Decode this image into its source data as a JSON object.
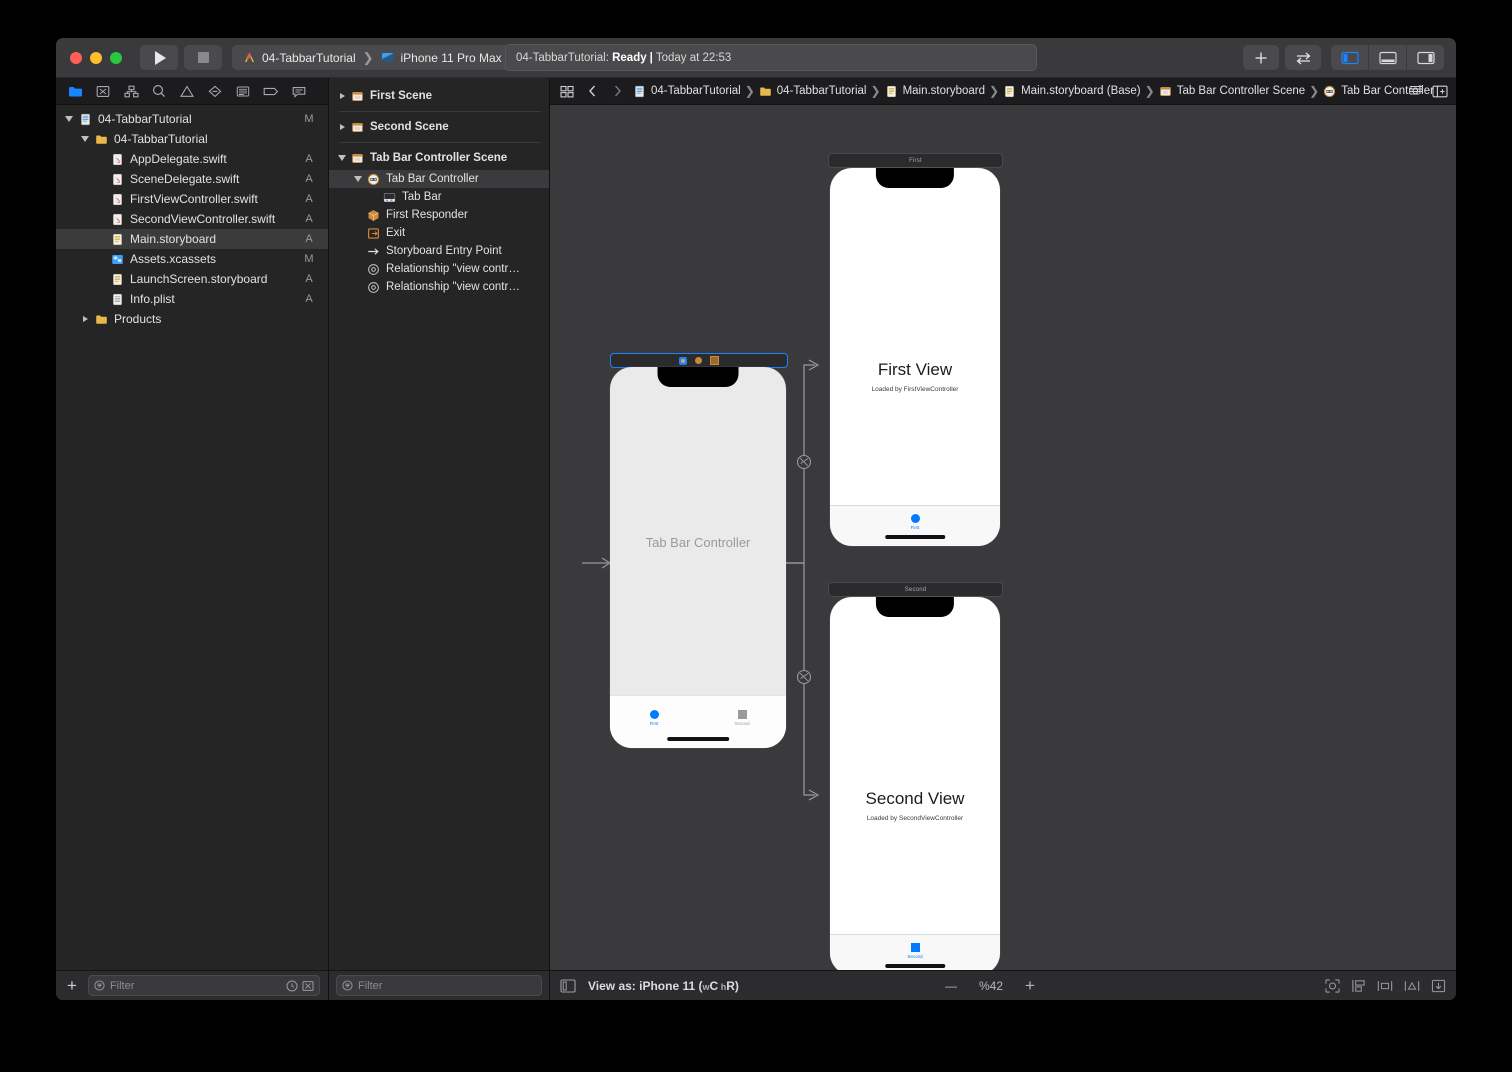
{
  "window": {
    "traffic_lights": [
      "close",
      "minimize",
      "zoom"
    ]
  },
  "toolbar": {
    "run_label": "Run",
    "stop_label": "Stop",
    "scheme_name": "04-TabbarTutorial",
    "destination_name": "iPhone 11 Pro Max",
    "status_project": "04-TabbarTutorial:",
    "status_state": "Ready",
    "status_separator": "|",
    "status_time": "Today at 22:53",
    "add_label": "+",
    "panel_left_label": "Navigator",
    "panel_bottom_label": "Debug Area",
    "panel_right_label": "Inspector",
    "accent_color": "#1a84ff"
  },
  "navigator": {
    "toolbar_icons": [
      "project-navigator-icon",
      "source-control-navigator-icon",
      "symbol-navigator-icon",
      "find-navigator-icon",
      "issue-navigator-icon",
      "test-navigator-icon",
      "debug-navigator-icon",
      "breakpoint-navigator-icon",
      "report-navigator-icon"
    ],
    "files": [
      {
        "label": "04-TabbarTutorial",
        "badge": "M",
        "indent": 0,
        "icon": "xcode-project-icon",
        "disclosure": "open",
        "selected": false
      },
      {
        "label": "04-TabbarTutorial",
        "badge": "",
        "indent": 1,
        "icon": "folder-icon",
        "disclosure": "open",
        "selected": false
      },
      {
        "label": "AppDelegate.swift",
        "badge": "A",
        "indent": 2,
        "icon": "swift-file-icon",
        "disclosure": "none",
        "selected": false
      },
      {
        "label": "SceneDelegate.swift",
        "badge": "A",
        "indent": 2,
        "icon": "swift-file-icon",
        "disclosure": "none",
        "selected": false
      },
      {
        "label": "FirstViewController.swift",
        "badge": "A",
        "indent": 2,
        "icon": "swift-file-icon",
        "disclosure": "none",
        "selected": false
      },
      {
        "label": "SecondViewController.swift",
        "badge": "A",
        "indent": 2,
        "icon": "swift-file-icon",
        "disclosure": "none",
        "selected": false
      },
      {
        "label": "Main.storyboard",
        "badge": "A",
        "indent": 2,
        "icon": "storyboard-file-icon",
        "disclosure": "none",
        "selected": true
      },
      {
        "label": "Assets.xcassets",
        "badge": "M",
        "indent": 2,
        "icon": "assets-catalog-icon",
        "disclosure": "none",
        "selected": false
      },
      {
        "label": "LaunchScreen.storyboard",
        "badge": "A",
        "indent": 2,
        "icon": "storyboard-file-icon",
        "disclosure": "none",
        "selected": false
      },
      {
        "label": "Info.plist",
        "badge": "A",
        "indent": 2,
        "icon": "plist-file-icon",
        "disclosure": "none",
        "selected": false
      },
      {
        "label": "Products",
        "badge": "",
        "indent": 1,
        "icon": "folder-icon",
        "disclosure": "closed",
        "selected": false
      }
    ],
    "footer": {
      "add_label": "+",
      "filter_placeholder": "Filter",
      "filter_value": "",
      "recent_icon": "clock-icon",
      "scm_icon": "source-control-icon"
    }
  },
  "outline": {
    "rows": [
      {
        "label": "First Scene",
        "indent": 0,
        "icon": "scene-icon",
        "disclosure": "closed",
        "selected": false,
        "type": "scene"
      },
      {
        "label": "Second Scene",
        "indent": 0,
        "icon": "scene-icon",
        "disclosure": "closed",
        "selected": false,
        "type": "scene"
      },
      {
        "label": "Tab Bar Controller Scene",
        "indent": 0,
        "icon": "scene-icon",
        "disclosure": "open",
        "selected": false,
        "type": "scene"
      },
      {
        "label": "Tab Bar Controller",
        "indent": 1,
        "icon": "tab-bar-controller-icon",
        "disclosure": "open",
        "selected": true,
        "type": "item"
      },
      {
        "label": "Tab Bar",
        "indent": 2,
        "icon": "tab-bar-icon",
        "disclosure": "none",
        "selected": false,
        "type": "item"
      },
      {
        "label": "First Responder",
        "indent": 1,
        "icon": "first-responder-icon",
        "disclosure": "none",
        "selected": false,
        "type": "item"
      },
      {
        "label": "Exit",
        "indent": 1,
        "icon": "exit-icon",
        "disclosure": "none",
        "selected": false,
        "type": "item"
      },
      {
        "label": "Storyboard Entry Point",
        "indent": 1,
        "icon": "entry-point-icon",
        "disclosure": "none",
        "selected": false,
        "type": "item"
      },
      {
        "label": "Relationship \"view contr…",
        "indent": 1,
        "icon": "relationship-segue-icon",
        "disclosure": "none",
        "selected": false,
        "type": "item"
      },
      {
        "label": "Relationship \"view contr…",
        "indent": 1,
        "icon": "relationship-segue-icon",
        "disclosure": "none",
        "selected": false,
        "type": "item"
      }
    ],
    "footer": {
      "filter_placeholder": "Filter",
      "filter_value": ""
    }
  },
  "jump_bar": {
    "grid_icon": "related-items-icon",
    "back_label": "Back",
    "forward_label": "Forward",
    "crumbs": [
      {
        "label": "04-TabbarTutorial",
        "icon": "xcode-project-icon"
      },
      {
        "label": "04-TabbarTutorial",
        "icon": "folder-icon"
      },
      {
        "label": "Main.storyboard",
        "icon": "storyboard-file-icon"
      },
      {
        "label": "Main.storyboard (Base)",
        "icon": "storyboard-file-icon"
      },
      {
        "label": "Tab Bar Controller Scene",
        "icon": "scene-icon"
      },
      {
        "label": "Tab Bar Controller",
        "icon": "tab-bar-controller-icon"
      }
    ],
    "right_icons": [
      "minimap-icon",
      "add-editor-icon"
    ]
  },
  "canvas": {
    "scenes": {
      "tab_bar_controller": {
        "bar_icons": [
          "tab-bar-controller-icon",
          "first-responder-icon",
          "exit-icon"
        ],
        "placeholder_label": "Tab Bar Controller",
        "selected": true,
        "tabs": [
          {
            "label": "First",
            "icon": "circle-icon",
            "selected": true
          },
          {
            "label": "Second",
            "icon": "square-icon",
            "selected": false
          }
        ]
      },
      "first": {
        "bar_label": "First",
        "title": "First View",
        "subtitle": "Loaded by FirstViewController",
        "tabs": [
          {
            "label": "First",
            "icon": "circle-icon",
            "selected": true
          }
        ]
      },
      "second": {
        "bar_label": "Second",
        "title": "Second View",
        "subtitle": "Loaded by SecondViewController",
        "tabs": [
          {
            "label": "Second",
            "icon": "square-icon",
            "selected": true
          }
        ]
      }
    }
  },
  "canvas_footer": {
    "device_selector_icon": "device-bezel-icon",
    "view_as_label": "View as: iPhone 11 (",
    "size_class_w": "w",
    "size_class_c": "C",
    "size_class_h": " h",
    "size_class_r": "R)",
    "zoom_out": "—",
    "zoom_level": "%42",
    "zoom_in": "+",
    "tools": [
      "update-frames-icon",
      "embed-in-icon",
      "align-icon",
      "add-constraints-icon",
      "resolve-auto-layout-issues-icon"
    ]
  }
}
